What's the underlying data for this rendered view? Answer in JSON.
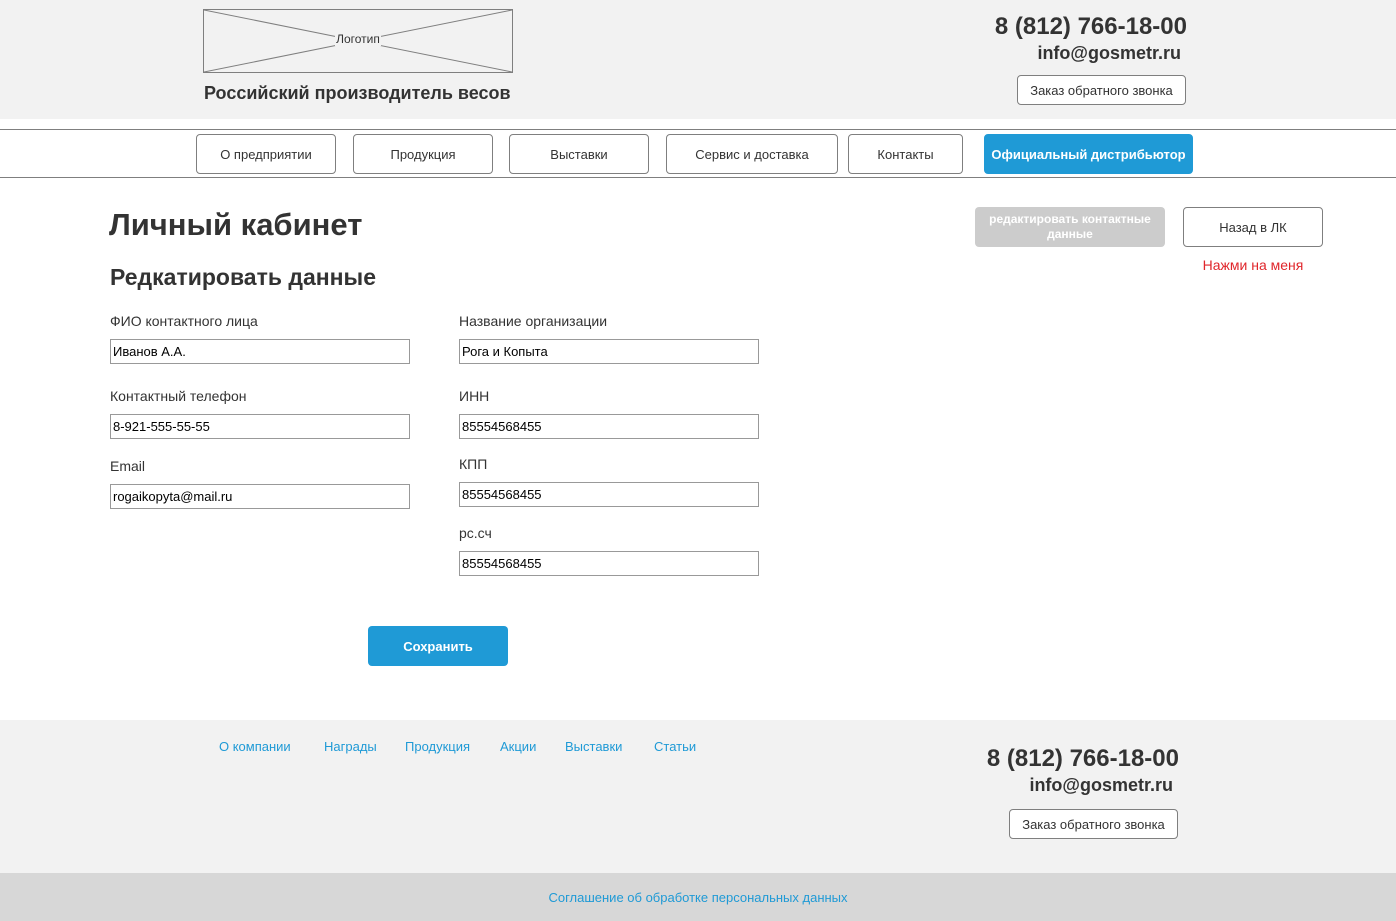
{
  "header": {
    "logo_label": "Логотип",
    "tagline": "Российский производитель весов",
    "phone": "8 (812) 766-18-00",
    "email": "info@gosmetr.ru",
    "callback_label": "Заказ обратного звонка"
  },
  "nav": {
    "items": [
      {
        "label": "О предприятии"
      },
      {
        "label": "Продукция"
      },
      {
        "label": "Выставки"
      },
      {
        "label": "Сервис и доставка"
      },
      {
        "label": "Контакты"
      },
      {
        "label": "Официальный дистрибьютор",
        "active": true
      }
    ]
  },
  "main": {
    "page_title": "Личный кабинет",
    "section_title": "Редкатировать данные",
    "edit_contacts_label": "редактировать контактные данные",
    "back_label": "Назад в ЛК",
    "hint": "Нажми на меня",
    "fields": {
      "fio": {
        "label": "ФИО контактного лица",
        "value": "Иванов А.А."
      },
      "phone": {
        "label": "Контактный телефон",
        "value": "8-921-555-55-55"
      },
      "email": {
        "label": "Email",
        "value": "rogaikopyta@mail.ru"
      },
      "org": {
        "label": "Название организации",
        "value": "Рога и Копыта"
      },
      "inn": {
        "label": "ИНН",
        "value": "85554568455"
      },
      "kpp": {
        "label": "КПП",
        "value": "85554568455"
      },
      "account": {
        "label": "рс.сч",
        "value": "85554568455"
      }
    },
    "save_label": "Сохранить"
  },
  "footer": {
    "links": [
      "О компании",
      "Награды",
      "Продукция",
      "Акции",
      "Выставки",
      "Статьи"
    ],
    "phone": "8 (812) 766-18-00",
    "email": "info@gosmetr.ru",
    "callback_label": "Заказ обратного звонка",
    "agreement": "Соглашение об обработке персональных данных"
  },
  "colors": {
    "accent": "#1f9ad6",
    "header_bg": "#f2f2f2",
    "disabled": "#cccccc",
    "hint": "#e0262b"
  }
}
